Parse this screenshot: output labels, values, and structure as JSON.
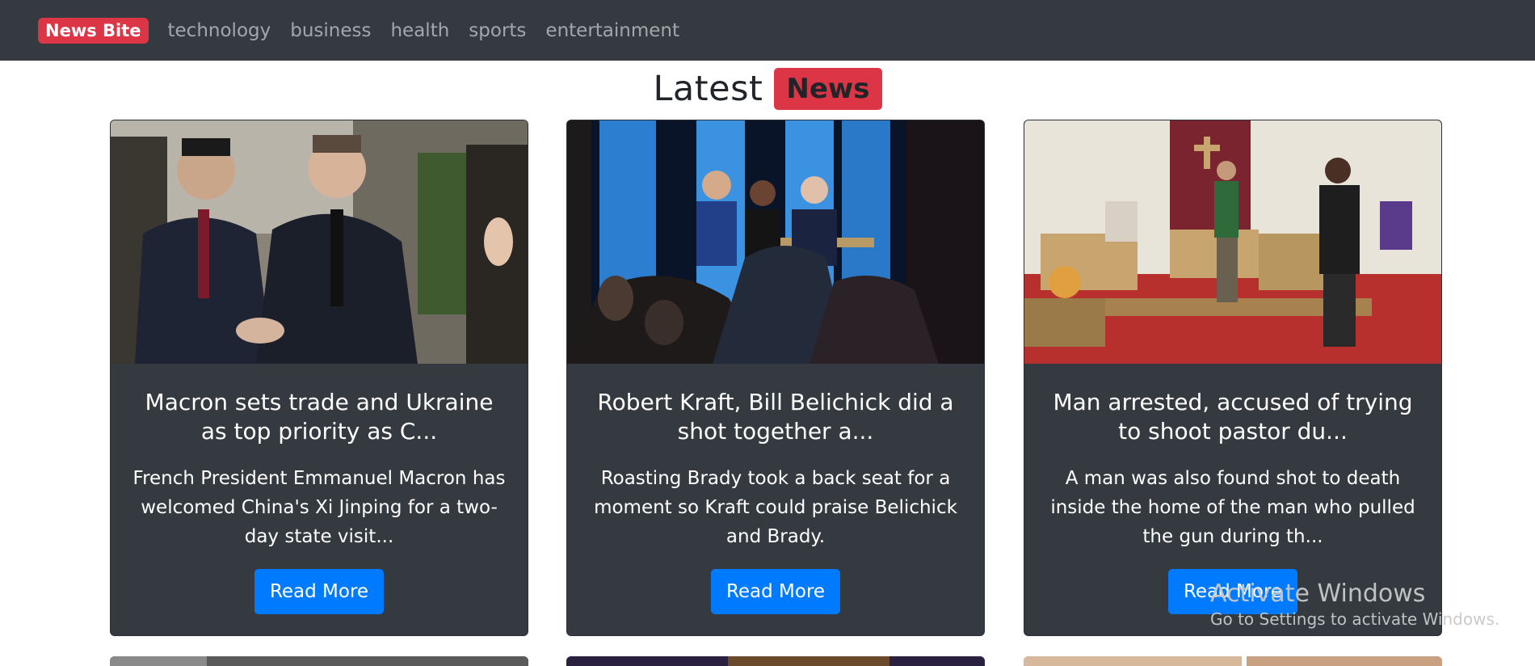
{
  "navbar": {
    "brand": "News Bite",
    "links": [
      "technology",
      "business",
      "health",
      "sports",
      "entertainment"
    ]
  },
  "heading": {
    "text": "Latest",
    "badge": "News"
  },
  "cards": [
    {
      "title": "Macron sets trade and Ukraine as top priority as C...",
      "description": "French President Emmanuel Macron has welcomed China's Xi Jinping for a two-day state visit...",
      "button": "Read More"
    },
    {
      "title": "Robert Kraft, Bill Belichick did a shot together a...",
      "description": "Roasting Brady took a back seat for a moment so Kraft could praise Belichick and Brady.",
      "button": "Read More"
    },
    {
      "title": "Man arrested, accused of trying to shoot pastor du...",
      "description": "A man was also found shot to death inside the home of the man who pulled the gun during th...",
      "button": "Read More"
    }
  ],
  "watermark": {
    "title": "Activate Windows",
    "subtitle": "Go to Settings to activate Windows."
  },
  "colors": {
    "navbar": "#343a40",
    "brand": "#dc3545",
    "button": "#007bff",
    "card": "#343a40"
  }
}
